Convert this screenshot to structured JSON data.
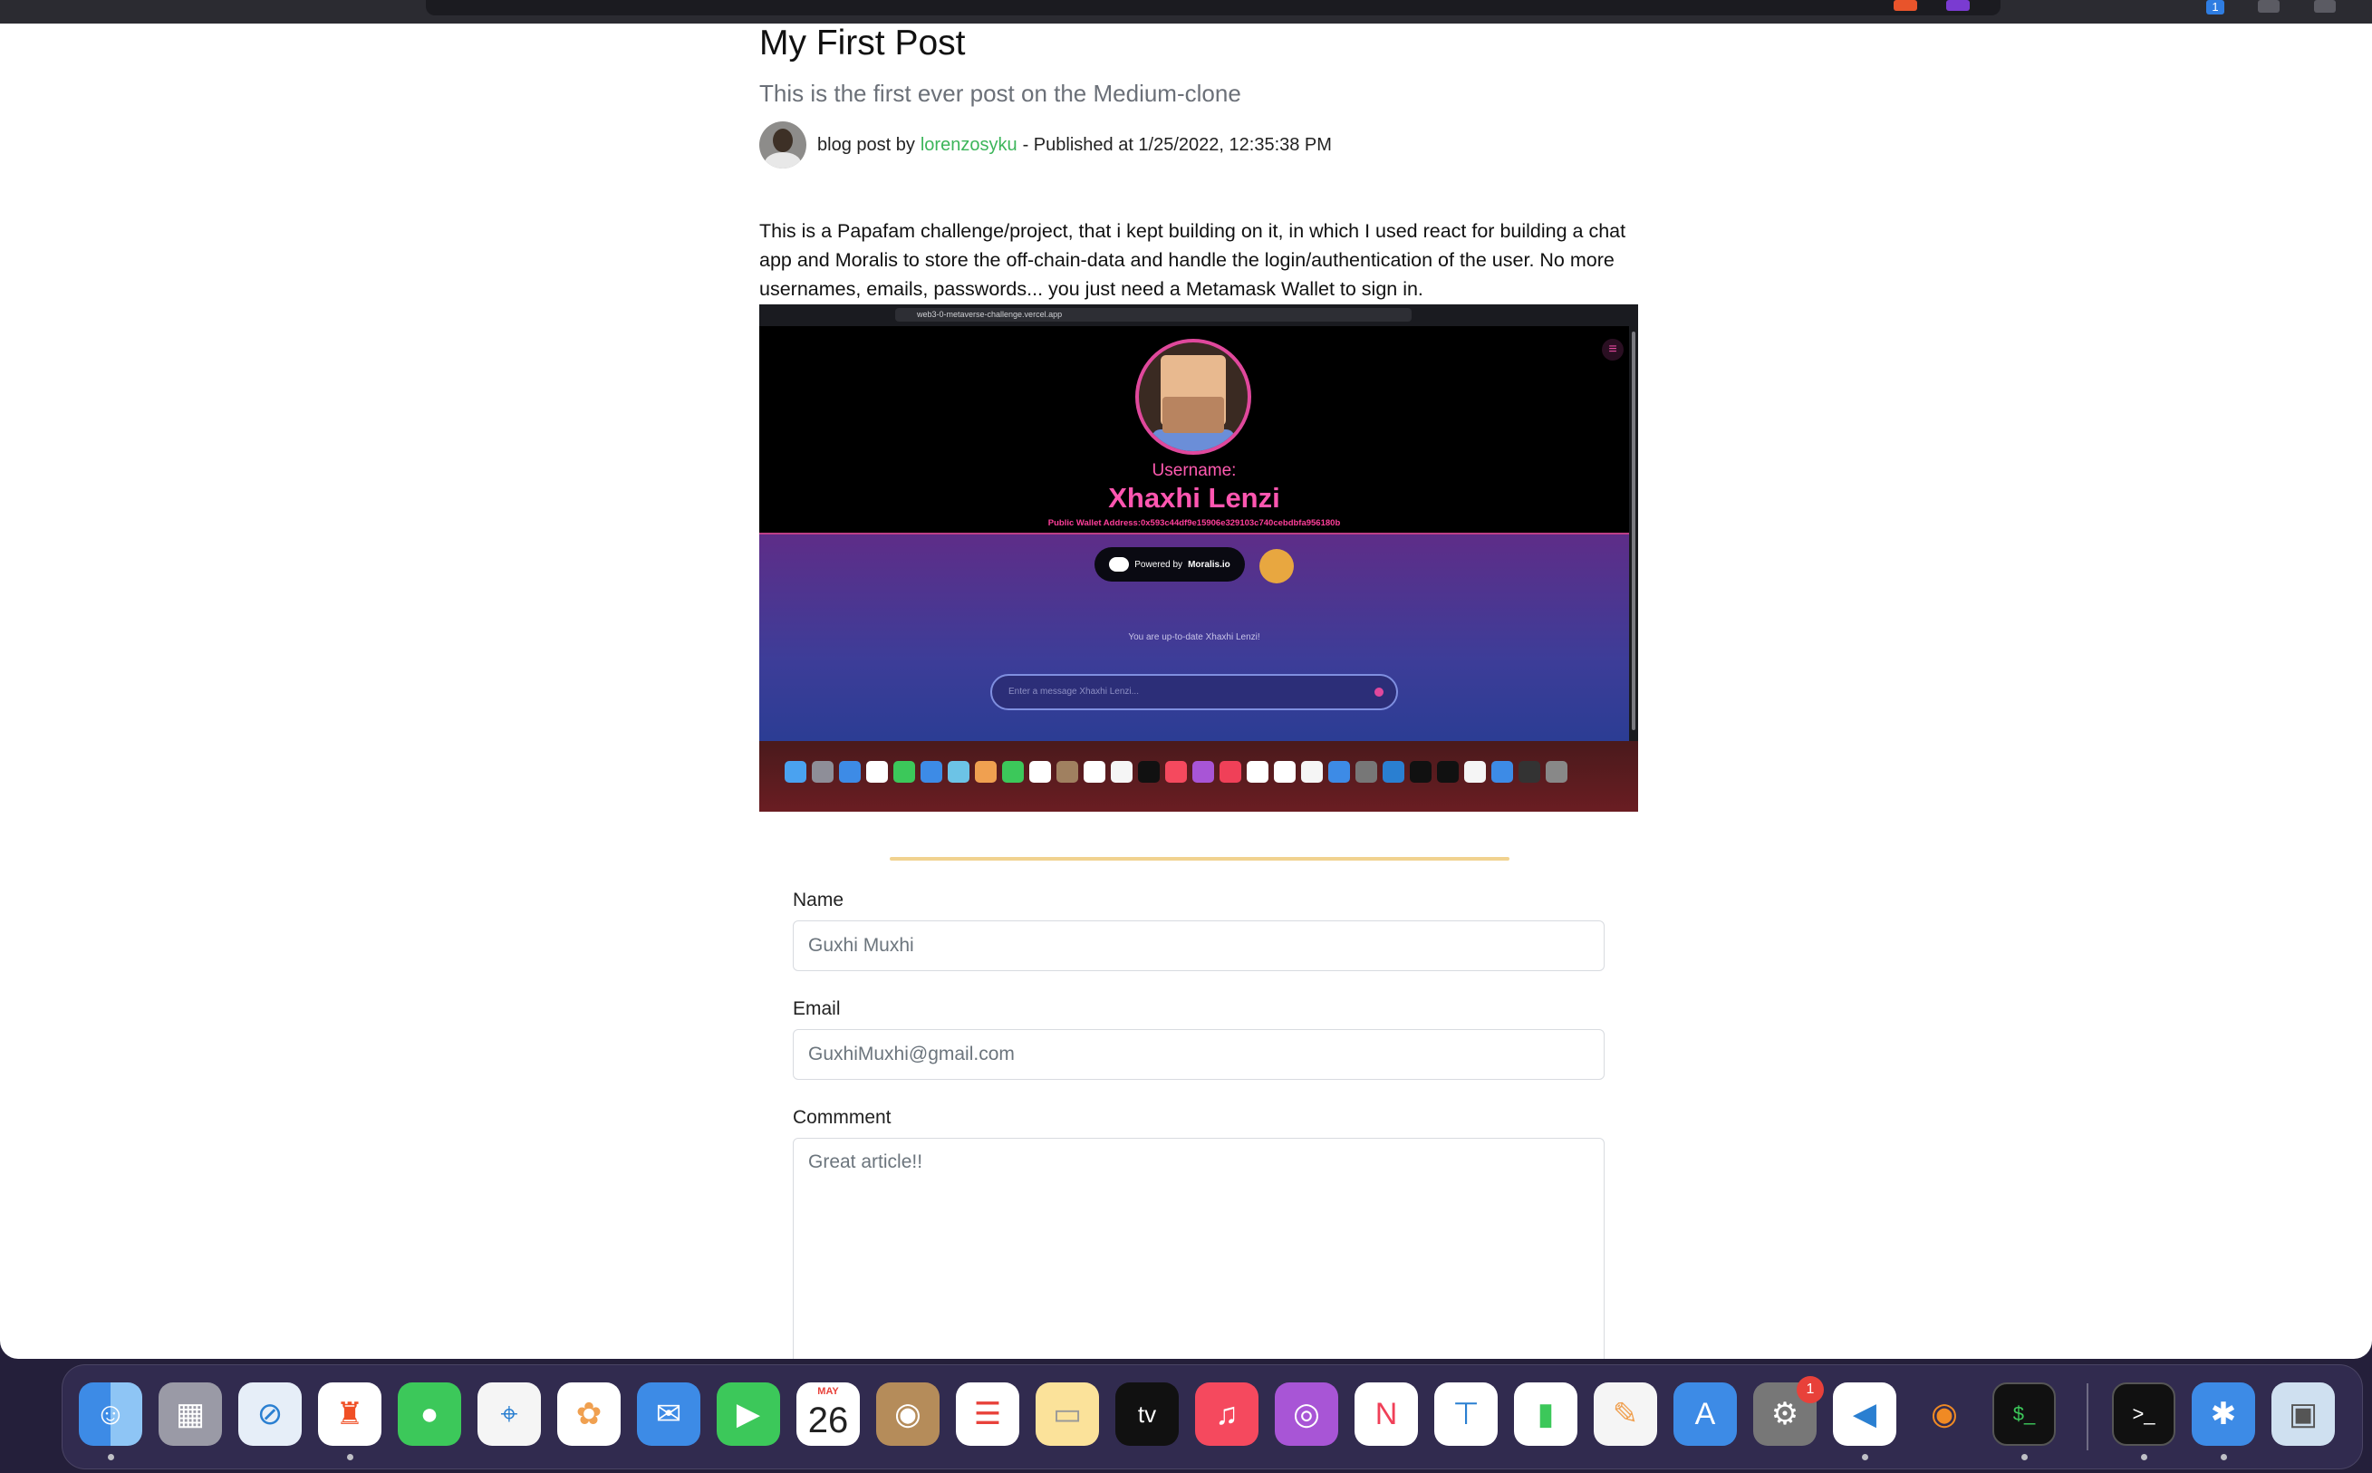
{
  "browser": {
    "notification_count": "1"
  },
  "post": {
    "title": "My First Post",
    "subtitle": "This is the first ever post on the Medium-clone",
    "meta_prefix": "blog post by",
    "author": "lorenzosyku",
    "meta_suffix": "- Published at 1/25/2022, 12:35:38 PM",
    "body": "This is a Papafam challenge/project, that i kept building on it, in which I used react for building a chat app and Moralis to store the off-chain-data and handle the login/authentication of the user. No more usernames, emails, passwords... you just need a Metamask Wallet to sign in."
  },
  "screenshot": {
    "url": "web3-0-metaverse-challenge.vercel.app",
    "username_label": "Username:",
    "username": "Xhaxhi Lenzi",
    "wallet": "Public Wallet Address:0x593c44df9e15906e329103c740cebdbfa956180b",
    "powered_prefix": "Powered by",
    "powered_brand": "Moralis.io",
    "uptodate": "You are up-to-date Xhaxhi Lenzi!",
    "message_placeholder": "Enter a message Xhaxhi Lenzi..."
  },
  "form": {
    "name_label": "Name",
    "name_placeholder": "Guxhi Muxhi",
    "email_label": "Email",
    "email_placeholder": "GuxhiMuxhi@gmail.com",
    "comment_label": "Commment",
    "comment_placeholder": "Great article!!"
  },
  "dock": {
    "calendar_month": "MAY",
    "calendar_day": "26",
    "settings_badge": "1",
    "apps": [
      "finder-icon",
      "launchpad-icon",
      "safari-icon",
      "brave-icon",
      "messages-icon",
      "maps-icon",
      "photos-icon",
      "mail-icon",
      "facetime-icon",
      "calendar-icon",
      "contacts-icon",
      "reminders-icon",
      "notes-icon",
      "apple-tv-icon",
      "music-icon",
      "podcasts-icon",
      "news-icon",
      "keynote-icon",
      "numbers-icon",
      "pages-icon",
      "app-store-icon",
      "system-preferences-icon",
      "vscode-icon",
      "blender-icon",
      "terminal-icon",
      "terminal-icon",
      "bluetooth-icon",
      "preview-icon"
    ]
  },
  "colors": {
    "author_link": "#3cb55a",
    "divider": "#f1d28f",
    "accent_pink": "#ff56b0"
  }
}
